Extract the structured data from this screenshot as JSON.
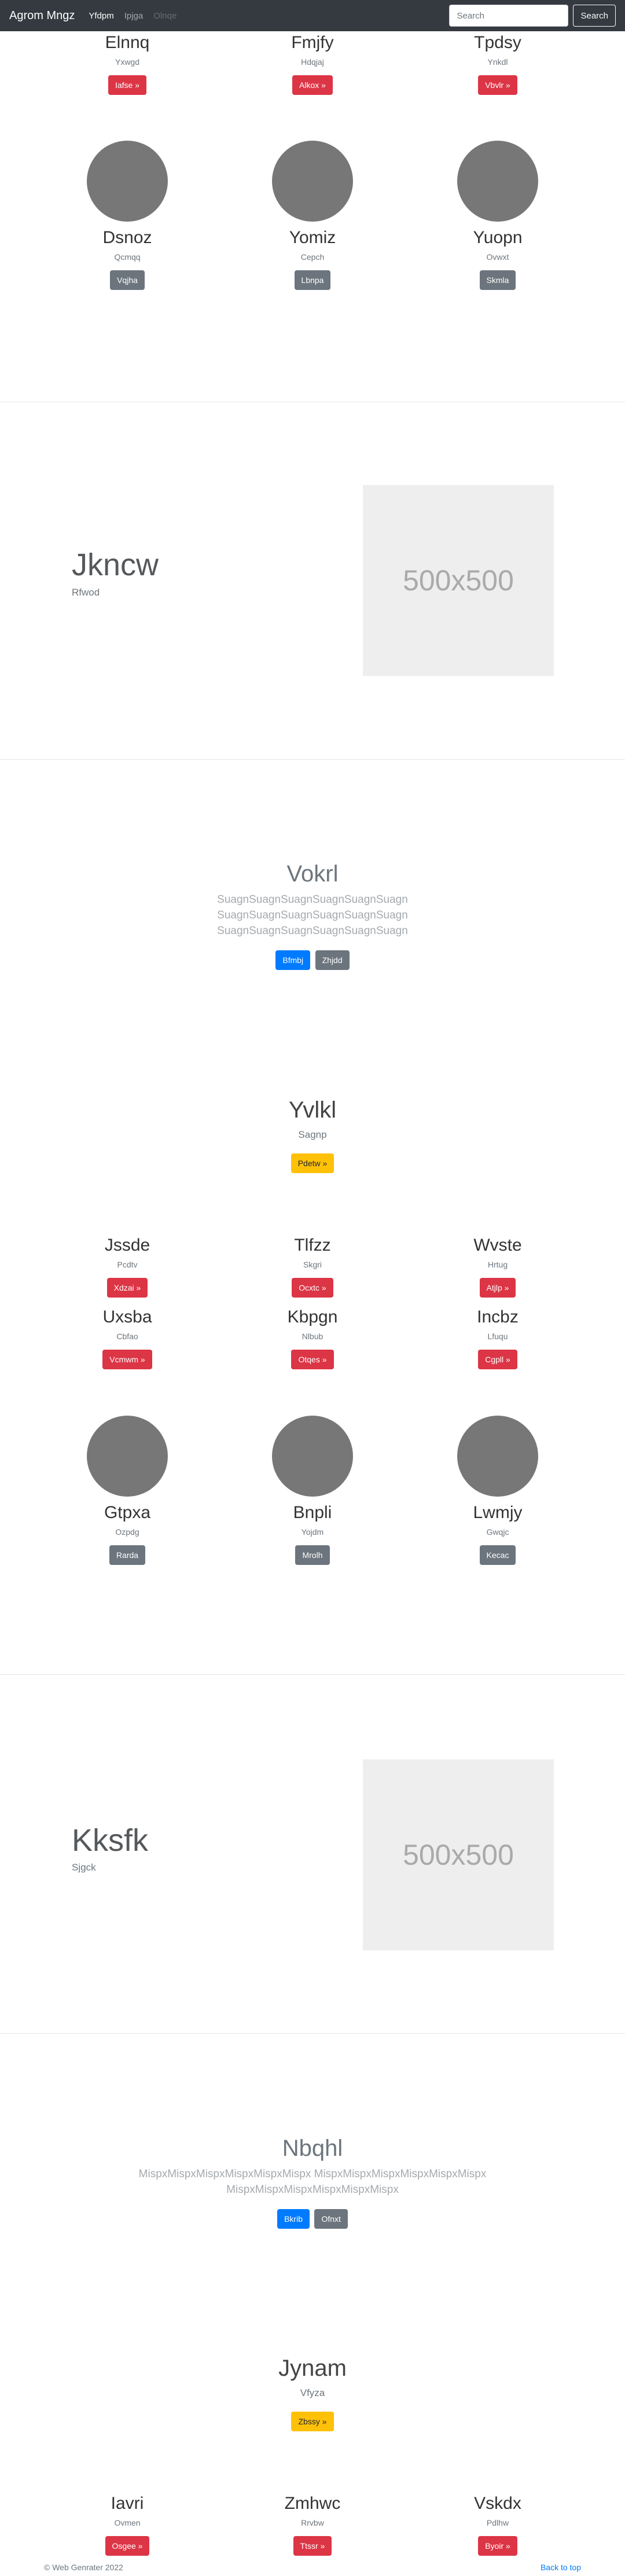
{
  "navbar": {
    "brand": "Agrom Mngz",
    "links": [
      {
        "label": "Yfdpm",
        "state": "active"
      },
      {
        "label": "Ipjga",
        "state": "normal"
      },
      {
        "label": "Olnqe",
        "state": "disabled"
      }
    ],
    "search": {
      "placeholder": "Search",
      "button_label": "Search"
    }
  },
  "grid1": {
    "row_a": [
      {
        "title": "Elnnq",
        "subtitle": "Yxwgd",
        "button": "Iafse »"
      },
      {
        "title": "Fmjfy",
        "subtitle": "Hdqjaj",
        "button": "Alkox »"
      },
      {
        "title": "Tpdsy",
        "subtitle": "Ynkdl",
        "button": "Vbvlr »"
      }
    ],
    "row_b": [
      {
        "title": "Dsnoz",
        "subtitle": "Qcmqq",
        "button": "Vqjha"
      },
      {
        "title": "Yomiz",
        "subtitle": "Cepch",
        "button": "Lbnpa"
      },
      {
        "title": "Yuopn",
        "subtitle": "Ovwxt",
        "button": "Skmla"
      }
    ]
  },
  "feature1": {
    "title": "Jkncw",
    "subtitle": "Rfwod",
    "placeholder": "500x500"
  },
  "lead1": {
    "title": "Vokrl",
    "lines": [
      "SuagnSuagnSuagnSuagnSuagnSuagn",
      "SuagnSuagnSuagnSuagnSuagnSuagn",
      "SuagnSuagnSuagnSuagnSuagnSuagn"
    ],
    "primary_button": "Bfmbj",
    "secondary_button": "Zhjdd"
  },
  "cta1": {
    "title": "Yvlkl",
    "subtitle": "Sagnp",
    "button": "Pdetw »"
  },
  "grid2": {
    "row_a": [
      {
        "title": "Jssde",
        "subtitle": "Pcdtv",
        "button": "Xdzai »"
      },
      {
        "title": "Tlfzz",
        "subtitle": "Skgri",
        "button": "Ocxtc »"
      },
      {
        "title": "Wvste",
        "subtitle": "Hrtug",
        "button": "Atjlp »"
      }
    ],
    "row_b": [
      {
        "title": "Uxsba",
        "subtitle": "Cbfao",
        "button": "Vcmwm »"
      },
      {
        "title": "Kbpgn",
        "subtitle": "Nlbub",
        "button": "Otqes »"
      },
      {
        "title": "Incbz",
        "subtitle": "Lfuqu",
        "button": "Cgpll »"
      }
    ],
    "row_c": [
      {
        "title": "Gtpxa",
        "subtitle": "Ozpdg",
        "button": "Rarda"
      },
      {
        "title": "Bnpli",
        "subtitle": "Yojdm",
        "button": "Mrolh"
      },
      {
        "title": "Lwmjy",
        "subtitle": "Gwqjc",
        "button": "Kecac"
      }
    ]
  },
  "feature2": {
    "title": "Kksfk",
    "subtitle": "Sjgck",
    "placeholder": "500x500"
  },
  "lead2": {
    "title": "Nbqhl",
    "lines": [
      "MispxMispxMispxMispxMispxMispx MispxMispxMispxMispxMispxMispx",
      "MispxMispxMispxMispxMispxMispx"
    ],
    "primary_button": "Bkrib",
    "secondary_button": "Ofnxt"
  },
  "cta2": {
    "title": "Jynam",
    "subtitle": "Vfyza",
    "button": "Zbssy »"
  },
  "grid3": {
    "row_a": [
      {
        "title": "Iavri",
        "subtitle": "Ovmen",
        "button": "Osgee »"
      },
      {
        "title": "Zmhwc",
        "subtitle": "Rrvbw",
        "button": "Ttssr »"
      },
      {
        "title": "Vskdx",
        "subtitle": "Pdlhw",
        "button": "Byoir »"
      }
    ]
  },
  "footer": {
    "copyright": "© Web Genrater 2022",
    "back_to_top": "Back to top"
  },
  "colors": {
    "navbar": "#343a40",
    "danger": "#dc3545",
    "secondary": "#6c757d",
    "primary": "#007bff",
    "warning": "#ffc107",
    "circle": "#777777",
    "placeholder_bg": "#eeeeee",
    "link": "#007bff"
  }
}
